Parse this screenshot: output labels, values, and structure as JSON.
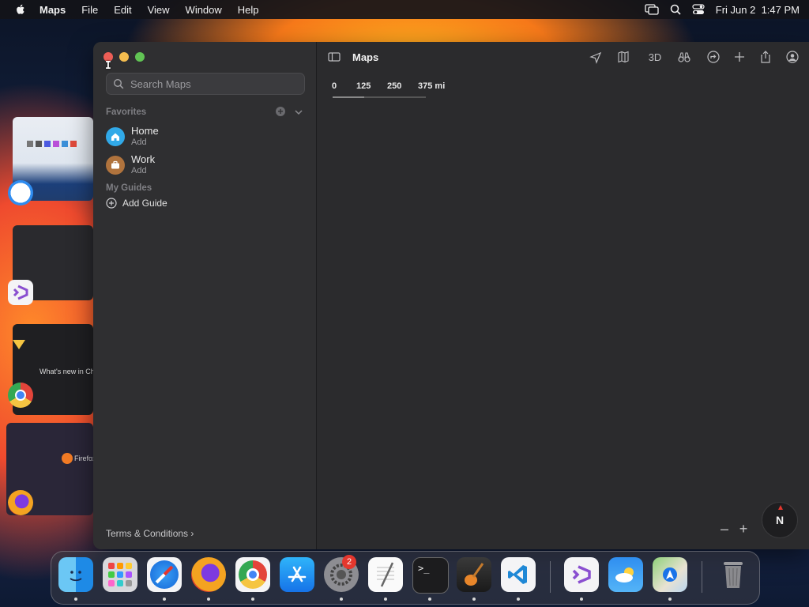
{
  "menubar": {
    "app_name": "Maps",
    "items": [
      "File",
      "Edit",
      "View",
      "Window",
      "Help"
    ],
    "clock": "Fri Jun 2  1:47 PM"
  },
  "window": {
    "title": "Maps",
    "toolbar": {
      "3d_label": "3D"
    }
  },
  "sidebar": {
    "search_placeholder": "Search Maps",
    "favorites_header": "Favorites",
    "favorites": [
      {
        "name": "Home",
        "sub": "Add",
        "color": "#31a9e8",
        "icon": "house-icon"
      },
      {
        "name": "Work",
        "sub": "Add",
        "color": "#b0733d",
        "icon": "briefcase-icon"
      }
    ],
    "guides_header": "My Guides",
    "add_guide": "Add Guide",
    "terms": "Terms & Conditions"
  },
  "map": {
    "scale_labels": [
      "0",
      "125",
      "250",
      "375 mi"
    ],
    "compass": "N"
  },
  "dock": {
    "apps": [
      "Finder",
      "Launchpad",
      "Safari",
      "Firefox",
      "Chrome",
      "App Store",
      "System Settings",
      "TextEdit",
      "Terminal",
      "GarageBand",
      "VS Code",
      "Visual Studio",
      "Weather",
      "Maps",
      "Trash"
    ],
    "settings_badge": "2"
  },
  "colors": {
    "accent_blue": "#31a9e8",
    "close": "#ed5e56",
    "minimize": "#f5bd4f",
    "zoom": "#61c454"
  }
}
